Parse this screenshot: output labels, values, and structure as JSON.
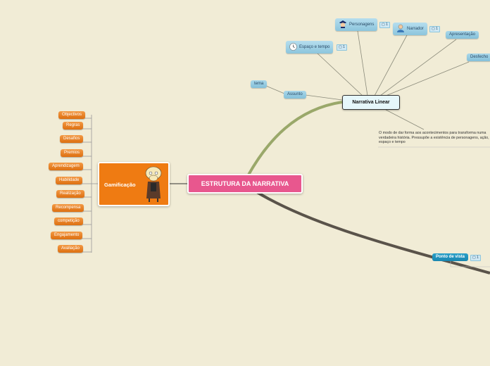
{
  "root": {
    "label": "ESTRUTURA DA NARRATIVA"
  },
  "gamificacao": {
    "label": "Gamificação",
    "items": [
      "Objectivos",
      "Regras",
      "Desafios",
      "Premios",
      "Aprendizagem",
      "Habilidade",
      "Realização",
      "Recompensa",
      "competição",
      "Engajamento",
      "Avaliação"
    ]
  },
  "narrativa_linear": {
    "label": "Narrativa Linear",
    "assunto": "Assunto",
    "tema": "tema",
    "personagens": "Personagens",
    "narrador": "Narrador",
    "espaco": "Espaço e tempo",
    "apresentacao": "Apresentação",
    "desfecho": "Desfecho",
    "badge_count": "1",
    "note": "O modo de dar forma aos acontecimentos para transforma numa verdadeira história. Pressupõe a existência de personagens, ação, espaço e tempo"
  },
  "ponto_de_vista": {
    "label": "Ponto de vista",
    "badge_count": "1"
  },
  "icons": [
    "police-icon",
    "user-icon",
    "clock-icon",
    "comment-icon",
    "cartoon-character-icon"
  ]
}
